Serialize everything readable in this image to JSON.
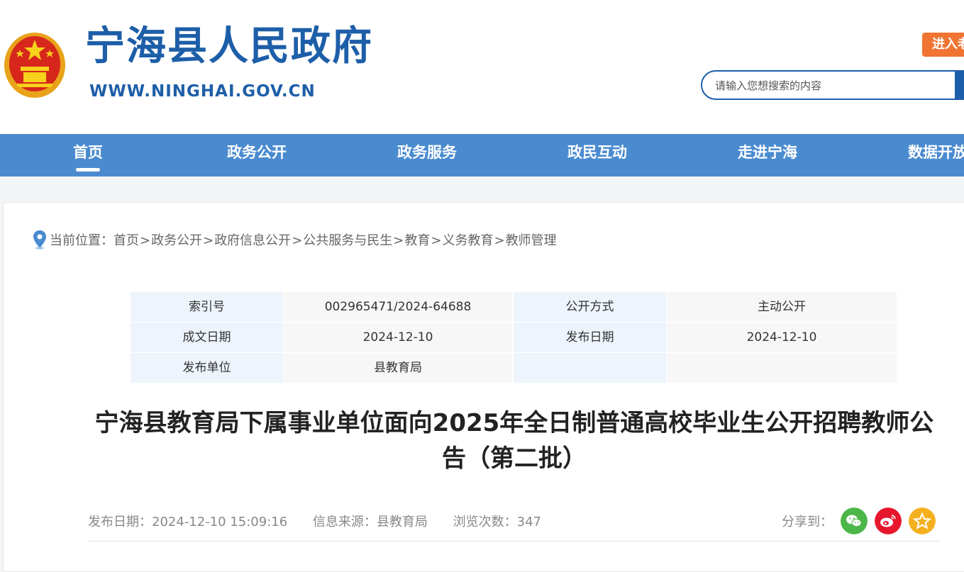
{
  "header": {
    "site_title": "宁海县人民政府",
    "site_url": "WWW.NINGHAI.GOV.CN",
    "enter_label": "进入老",
    "search_placeholder": "请输入您想搜索的内容"
  },
  "nav": {
    "items": [
      {
        "label": "首页",
        "active": true
      },
      {
        "label": "政务公开"
      },
      {
        "label": "政务服务"
      },
      {
        "label": "政民互动"
      },
      {
        "label": "走进宁海"
      },
      {
        "label": "数据开放"
      }
    ]
  },
  "breadcrumb": {
    "prefix": "当前位置：",
    "items": [
      "首页",
      "政务公开",
      "政府信息公开",
      "公共服务与民生",
      "教育",
      "义务教育",
      "教师管理"
    ],
    "separator": ">"
  },
  "meta": {
    "index_label": "索引号",
    "index_value": "002965471/2024-64688",
    "open_method_label": "公开方式",
    "open_method_value": "主动公开",
    "doc_date_label": "成文日期",
    "doc_date_value": "2024-12-10",
    "publish_date_label": "发布日期",
    "publish_date_value": "2024-12-10",
    "publisher_label": "发布单位",
    "publisher_value": "县教育局"
  },
  "article": {
    "title": "宁海县教育局下属事业单位面向2025年全日制普通高校毕业生公开招聘教师公告（第二批）",
    "publish_time": "发布日期：2024-12-10 15:09:16",
    "source": "信息来源：县教育局",
    "views": "浏览次数：347",
    "share_label": "分享到："
  },
  "colors": {
    "brand_blue": "#1d5ea8",
    "nav_blue": "#4a8bd0",
    "enter_orange": "#f07432",
    "wechat_green": "#4cb648",
    "weibo_red": "#e6162d",
    "favorite_yellow": "#f5b01f"
  },
  "icons": {
    "emblem": "national-emblem-icon",
    "location": "location-pin-icon",
    "share": [
      "wechat-icon",
      "weibo-icon",
      "star-icon"
    ]
  }
}
